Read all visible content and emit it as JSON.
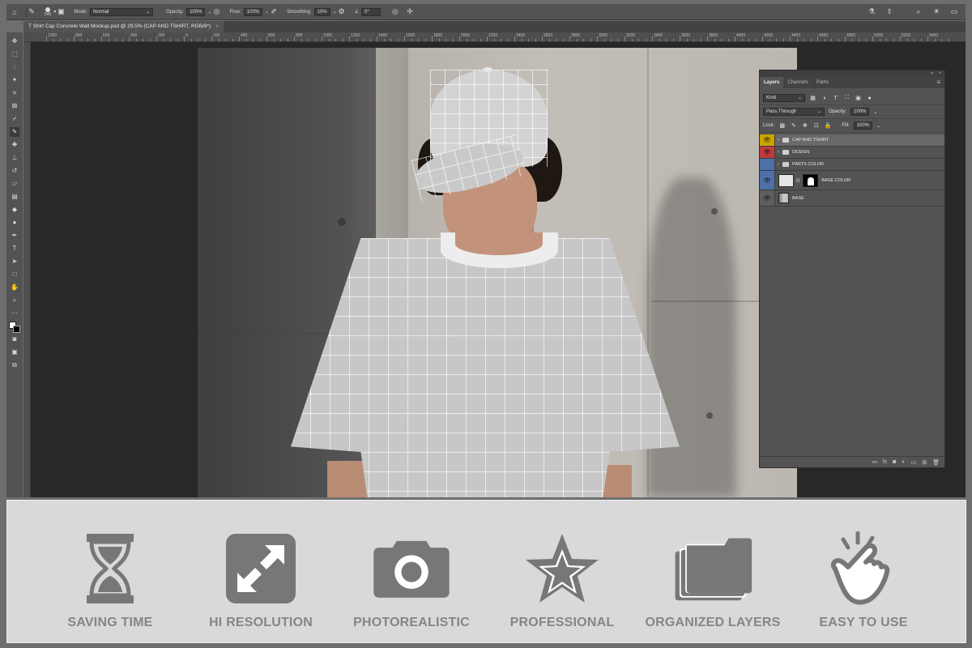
{
  "options_bar": {
    "brush_size": "545",
    "mode_label": "Mode:",
    "mode_value": "Normal",
    "opacity_label": "Opacity:",
    "opacity_value": "100%",
    "flow_label": "Flow:",
    "flow_value": "100%",
    "smoothing_label": "Smoothing:",
    "smoothing_value": "10%",
    "angle_value": "0°"
  },
  "document_tab": {
    "title": "T Shirt Cap Concrete Wall Mockup.psd @ 29,5% (CAP AND TSHIRT, RGB/8*)",
    "close": "×"
  },
  "ruler": {
    "labels": [
      "1000",
      "800",
      "600",
      "400",
      "200",
      "0",
      "200",
      "400",
      "600",
      "800",
      "1000",
      "1200",
      "1400",
      "1600",
      "1800",
      "2000",
      "2200",
      "2400",
      "2600",
      "2800",
      "3000",
      "3200",
      "3400",
      "3600",
      "3800",
      "4000",
      "4200",
      "4400",
      "4600",
      "4800",
      "5000",
      "5200",
      "5400",
      "5600"
    ]
  },
  "layers_panel": {
    "tabs": [
      "Layers",
      "Channels",
      "Paths"
    ],
    "active_tab": "Layers",
    "filter_kind": "Kind",
    "blend_mode": "Pass Through",
    "opacity_label": "Opacity:",
    "opacity_value": "100%",
    "lock_label": "Lock:",
    "fill_label": "Fill:",
    "fill_value": "100%",
    "layers": [
      {
        "name": "CAP AND TSHIRT",
        "eye_color": "#c9a400",
        "visible": true,
        "type": "group",
        "selected": true
      },
      {
        "name": "DESIGN",
        "eye_color": "#c0393b",
        "visible": true,
        "type": "group",
        "selected": false
      },
      {
        "name": "PARTS COLOR",
        "eye_color": "#4e6fa8",
        "visible": false,
        "type": "group",
        "selected": false
      },
      {
        "name": "BASE COLOR",
        "eye_color": "#4e6fa8",
        "visible": true,
        "type": "masked",
        "selected": false
      },
      {
        "name": "BASE",
        "eye_color": "#5d5d5d",
        "visible": true,
        "type": "image",
        "selected": false
      }
    ]
  },
  "features": [
    {
      "label": "SAVING TIME",
      "icon": "hourglass-icon"
    },
    {
      "label": "HI RESOLUTION",
      "icon": "expand-arrows-icon"
    },
    {
      "label": "PHOTOREALISTIC",
      "icon": "camera-icon"
    },
    {
      "label": "PROFESSIONAL",
      "icon": "star-icon"
    },
    {
      "label": "ORGANIZED LAYERS",
      "icon": "stacked-folders-icon"
    },
    {
      "label": "EASY TO USE",
      "icon": "tap-hand-icon"
    }
  ],
  "colors": {
    "feature_icon": "#777777",
    "feature_label": "#858585",
    "feature_band": "#d9d9d9",
    "panel_bg": "#535353"
  }
}
